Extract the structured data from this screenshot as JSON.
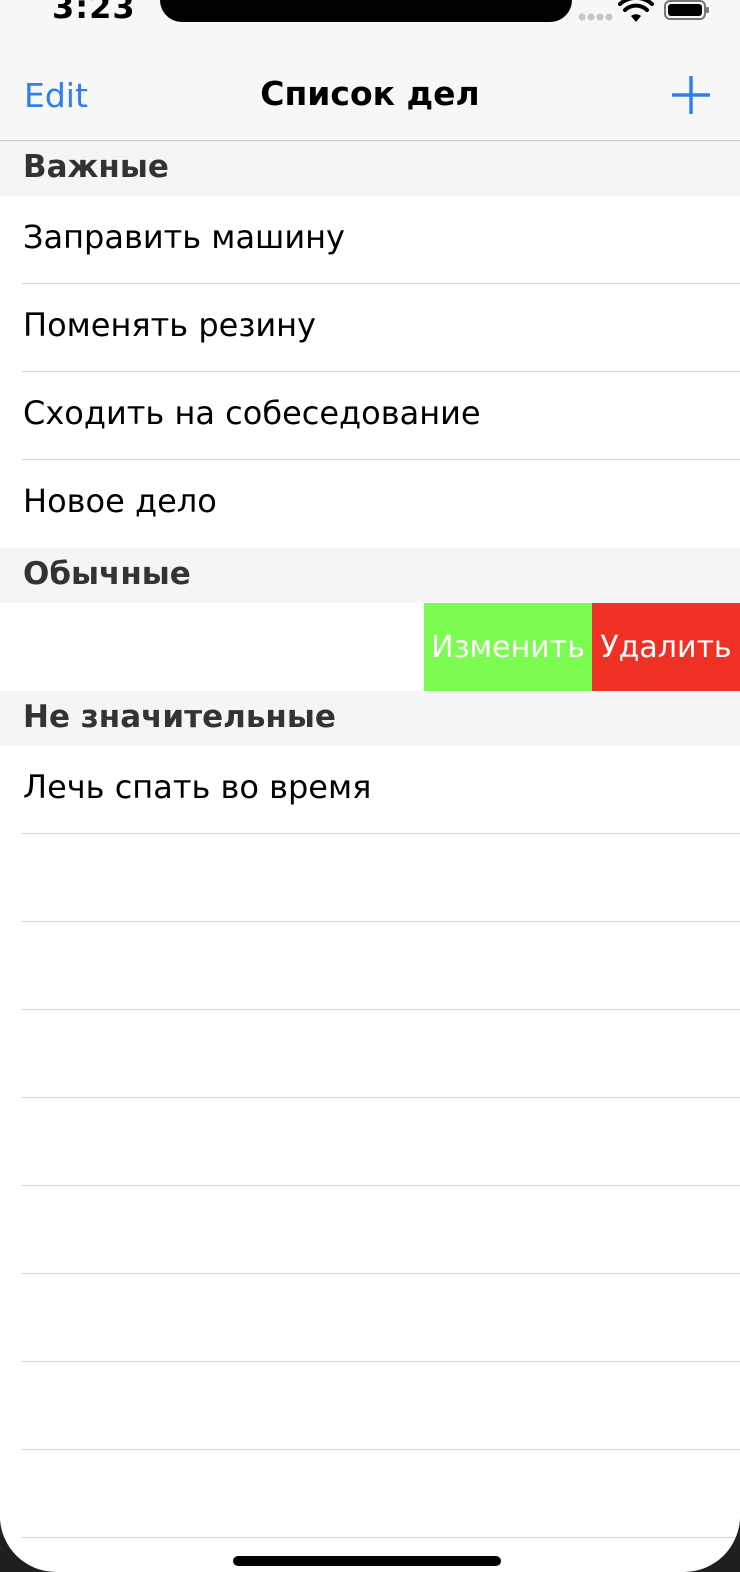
{
  "status_bar": {
    "time": "3:23"
  },
  "nav": {
    "edit_label": "Edit",
    "title": "Список дел",
    "add_icon": "plus-icon",
    "accent_color": "#2f80ed"
  },
  "sections": [
    {
      "header": "Важные",
      "items": [
        "Заправить машину",
        "Поменять резину",
        "Сходить на собеседование",
        "Новое дело"
      ]
    },
    {
      "header": "Обычные",
      "swipe_actions": {
        "edit_label": "Изменить",
        "edit_color": "#7cfc50",
        "delete_label": "Удалить",
        "delete_color": "#ee3124"
      }
    },
    {
      "header": "Не значительные",
      "items": [
        "Лечь спать во время"
      ]
    }
  ]
}
